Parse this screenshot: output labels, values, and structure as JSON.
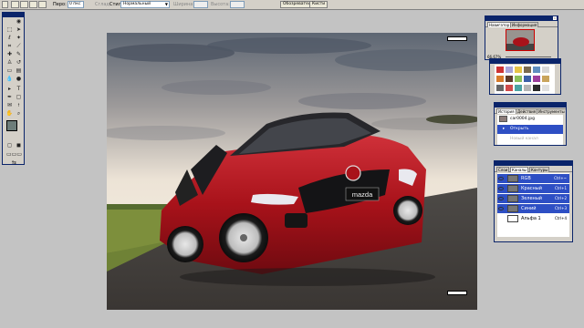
{
  "options_bar": {
    "brush_label": "Перо:",
    "brush_value": "0 пкс",
    "smooth_label": "Сглад.",
    "style_label": "Стиль:",
    "style_value": "Нормальный",
    "width_label": "Ширина",
    "height_label": "Высота:",
    "tab_browser": "Обозреватель",
    "tab_brushes": "Кисти"
  },
  "navigator": {
    "tab_navigator": "Навигатор",
    "tab_info": "Информация",
    "zoom": "66,67%"
  },
  "history": {
    "tabs": [
      "История",
      "Действия",
      "Инструменты"
    ],
    "items": [
      {
        "label": "car0004.jpg",
        "state": "normal"
      },
      {
        "label": "Открыть",
        "state": "selected"
      },
      {
        "label": "Новый канал",
        "state": "disabled"
      }
    ]
  },
  "channels": {
    "tabs": [
      "Слои",
      "Каналы",
      "Контуры"
    ],
    "rows": [
      {
        "name": "RGB",
        "shortcut": "Ctrl+~"
      },
      {
        "name": "Красный",
        "shortcut": "Ctrl+1"
      },
      {
        "name": "Зеленый",
        "shortcut": "Ctrl+2"
      },
      {
        "name": "Синий",
        "shortcut": "Ctrl+3"
      },
      {
        "name": "Альфа 1",
        "shortcut": "Ctrl+4"
      }
    ]
  },
  "car": {
    "badge": "mazda",
    "color": "#a8121a"
  },
  "colors": {
    "selection_blue": "#2e4fc4",
    "title_blue": "#0a246a",
    "workspace": "#c3c3c3"
  }
}
